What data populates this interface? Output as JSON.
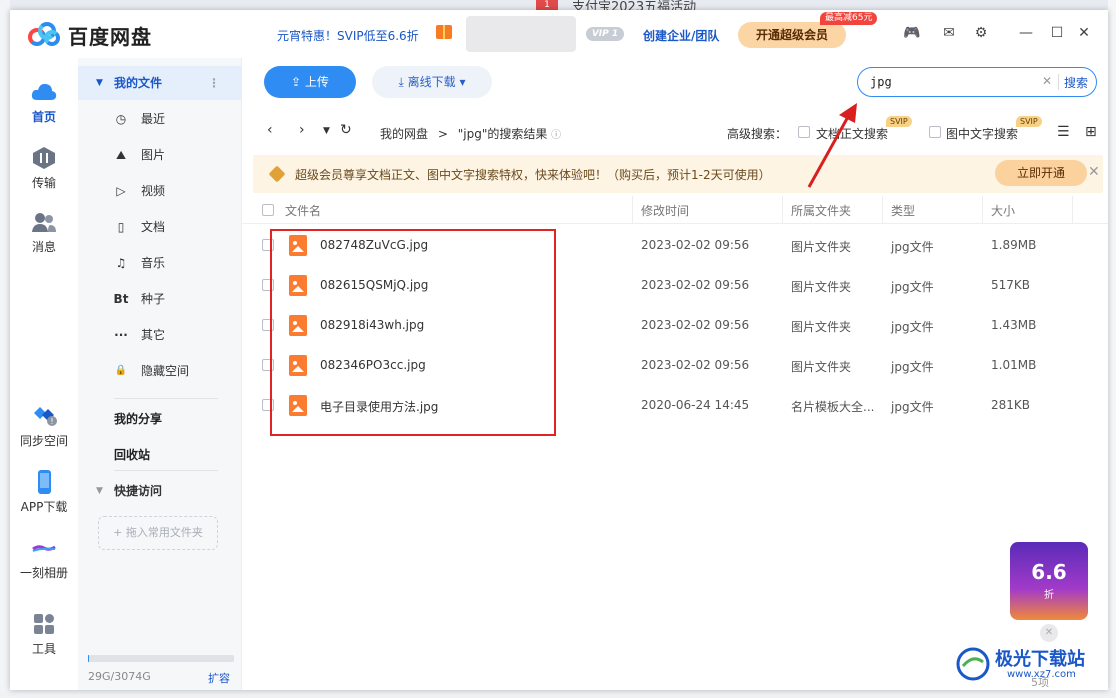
{
  "background": {
    "tab_badge": "1",
    "tab_text": "支付宝2023五福活动"
  },
  "app": {
    "title": "百度网盘",
    "promo": "元宵特惠！SVIP低至6.6折",
    "vip_badge": "VIP 1",
    "enterprise": "创建企业/团队",
    "vip_button": "开通超级会员",
    "vip_tag": "最高减65元"
  },
  "titlebar_icons": [
    {
      "name": "game-icon",
      "glyph": "🎮"
    },
    {
      "name": "mail-icon",
      "glyph": "✉"
    },
    {
      "name": "settings-icon",
      "glyph": "⚙"
    },
    {
      "name": "minimize-icon",
      "glyph": "—"
    },
    {
      "name": "maximize-icon",
      "glyph": "☐"
    },
    {
      "name": "close-icon",
      "glyph": "✕"
    }
  ],
  "leftnav": {
    "home": "首页",
    "transfer": "传输",
    "messages": "消息",
    "sync": "同步空间",
    "app_download": "APP下载",
    "album": "一刻相册",
    "tools": "工具"
  },
  "sidebar": {
    "my_files": "我的文件",
    "items": [
      {
        "label": "最近",
        "icon": "clock-icon",
        "glyph": "◷"
      },
      {
        "label": "图片",
        "icon": "image-icon",
        "glyph": "⛰"
      },
      {
        "label": "视频",
        "icon": "video-icon",
        "glyph": "▷"
      },
      {
        "label": "文档",
        "icon": "document-icon",
        "glyph": "▯"
      },
      {
        "label": "音乐",
        "icon": "music-icon",
        "glyph": "♫"
      },
      {
        "label": "种子",
        "icon": "torrent-icon",
        "glyph": "Bt"
      },
      {
        "label": "其它",
        "icon": "more-icon",
        "glyph": "···"
      },
      {
        "label": "隐藏空间",
        "icon": "lock-icon",
        "glyph": "🔒"
      }
    ],
    "my_share": "我的分享",
    "recycle": "回收站",
    "quick_access": "快捷访问",
    "drop_hint": "+ 拖入常用文件夹",
    "storage": "29G/3074G",
    "expand": "扩容"
  },
  "toolbar": {
    "upload": "上传",
    "offline": "离线下载"
  },
  "search": {
    "value": "jpg",
    "button": "搜索"
  },
  "nav": {
    "breadcrumb_root": "我的网盘",
    "breadcrumb_sep": ">",
    "breadcrumb_current": "\"jpg\"的搜索结果",
    "adv_label": "高级搜索：",
    "opt_doc": "文档正文搜索",
    "opt_img": "图中文字搜索",
    "svip": "SVIP"
  },
  "banner": {
    "text": "超级会员尊享文档正文、图中文字搜索特权，快来体验吧！（购买后，预计1-2天可使用）",
    "button": "立即开通"
  },
  "table": {
    "headers": [
      "文件名",
      "修改时间",
      "所属文件夹",
      "类型",
      "大小"
    ],
    "rows": [
      {
        "name": "082748ZuVcG.jpg",
        "time": "2023-02-02 09:56",
        "folder": "图片文件夹",
        "type": "jpg文件",
        "size": "1.89MB"
      },
      {
        "name": "082615QSMjQ.jpg",
        "time": "2023-02-02 09:56",
        "folder": "图片文件夹",
        "type": "jpg文件",
        "size": "517KB"
      },
      {
        "name": "082918i43wh.jpg",
        "time": "2023-02-02 09:56",
        "folder": "图片文件夹",
        "type": "jpg文件",
        "size": "1.43MB"
      },
      {
        "name": "082346PO3cc.jpg",
        "time": "2023-02-02 09:56",
        "folder": "图片文件夹",
        "type": "jpg文件",
        "size": "1.01MB"
      },
      {
        "name": "电子目录使用方法.jpg",
        "time": "2020-06-24 14:45",
        "folder": "名片模板大全...",
        "type": "jpg文件",
        "size": "281KB"
      }
    ]
  },
  "promo_card": {
    "number": "6.6",
    "sub": "折"
  },
  "page_count": "5项",
  "watermark": {
    "text": "极光下载站",
    "url": "www.xz7.com"
  },
  "colors": {
    "accent": "#2f8cf2",
    "link": "#1a57c8",
    "highlight_box": "#e02424",
    "file_icon": "#fb7b31"
  }
}
